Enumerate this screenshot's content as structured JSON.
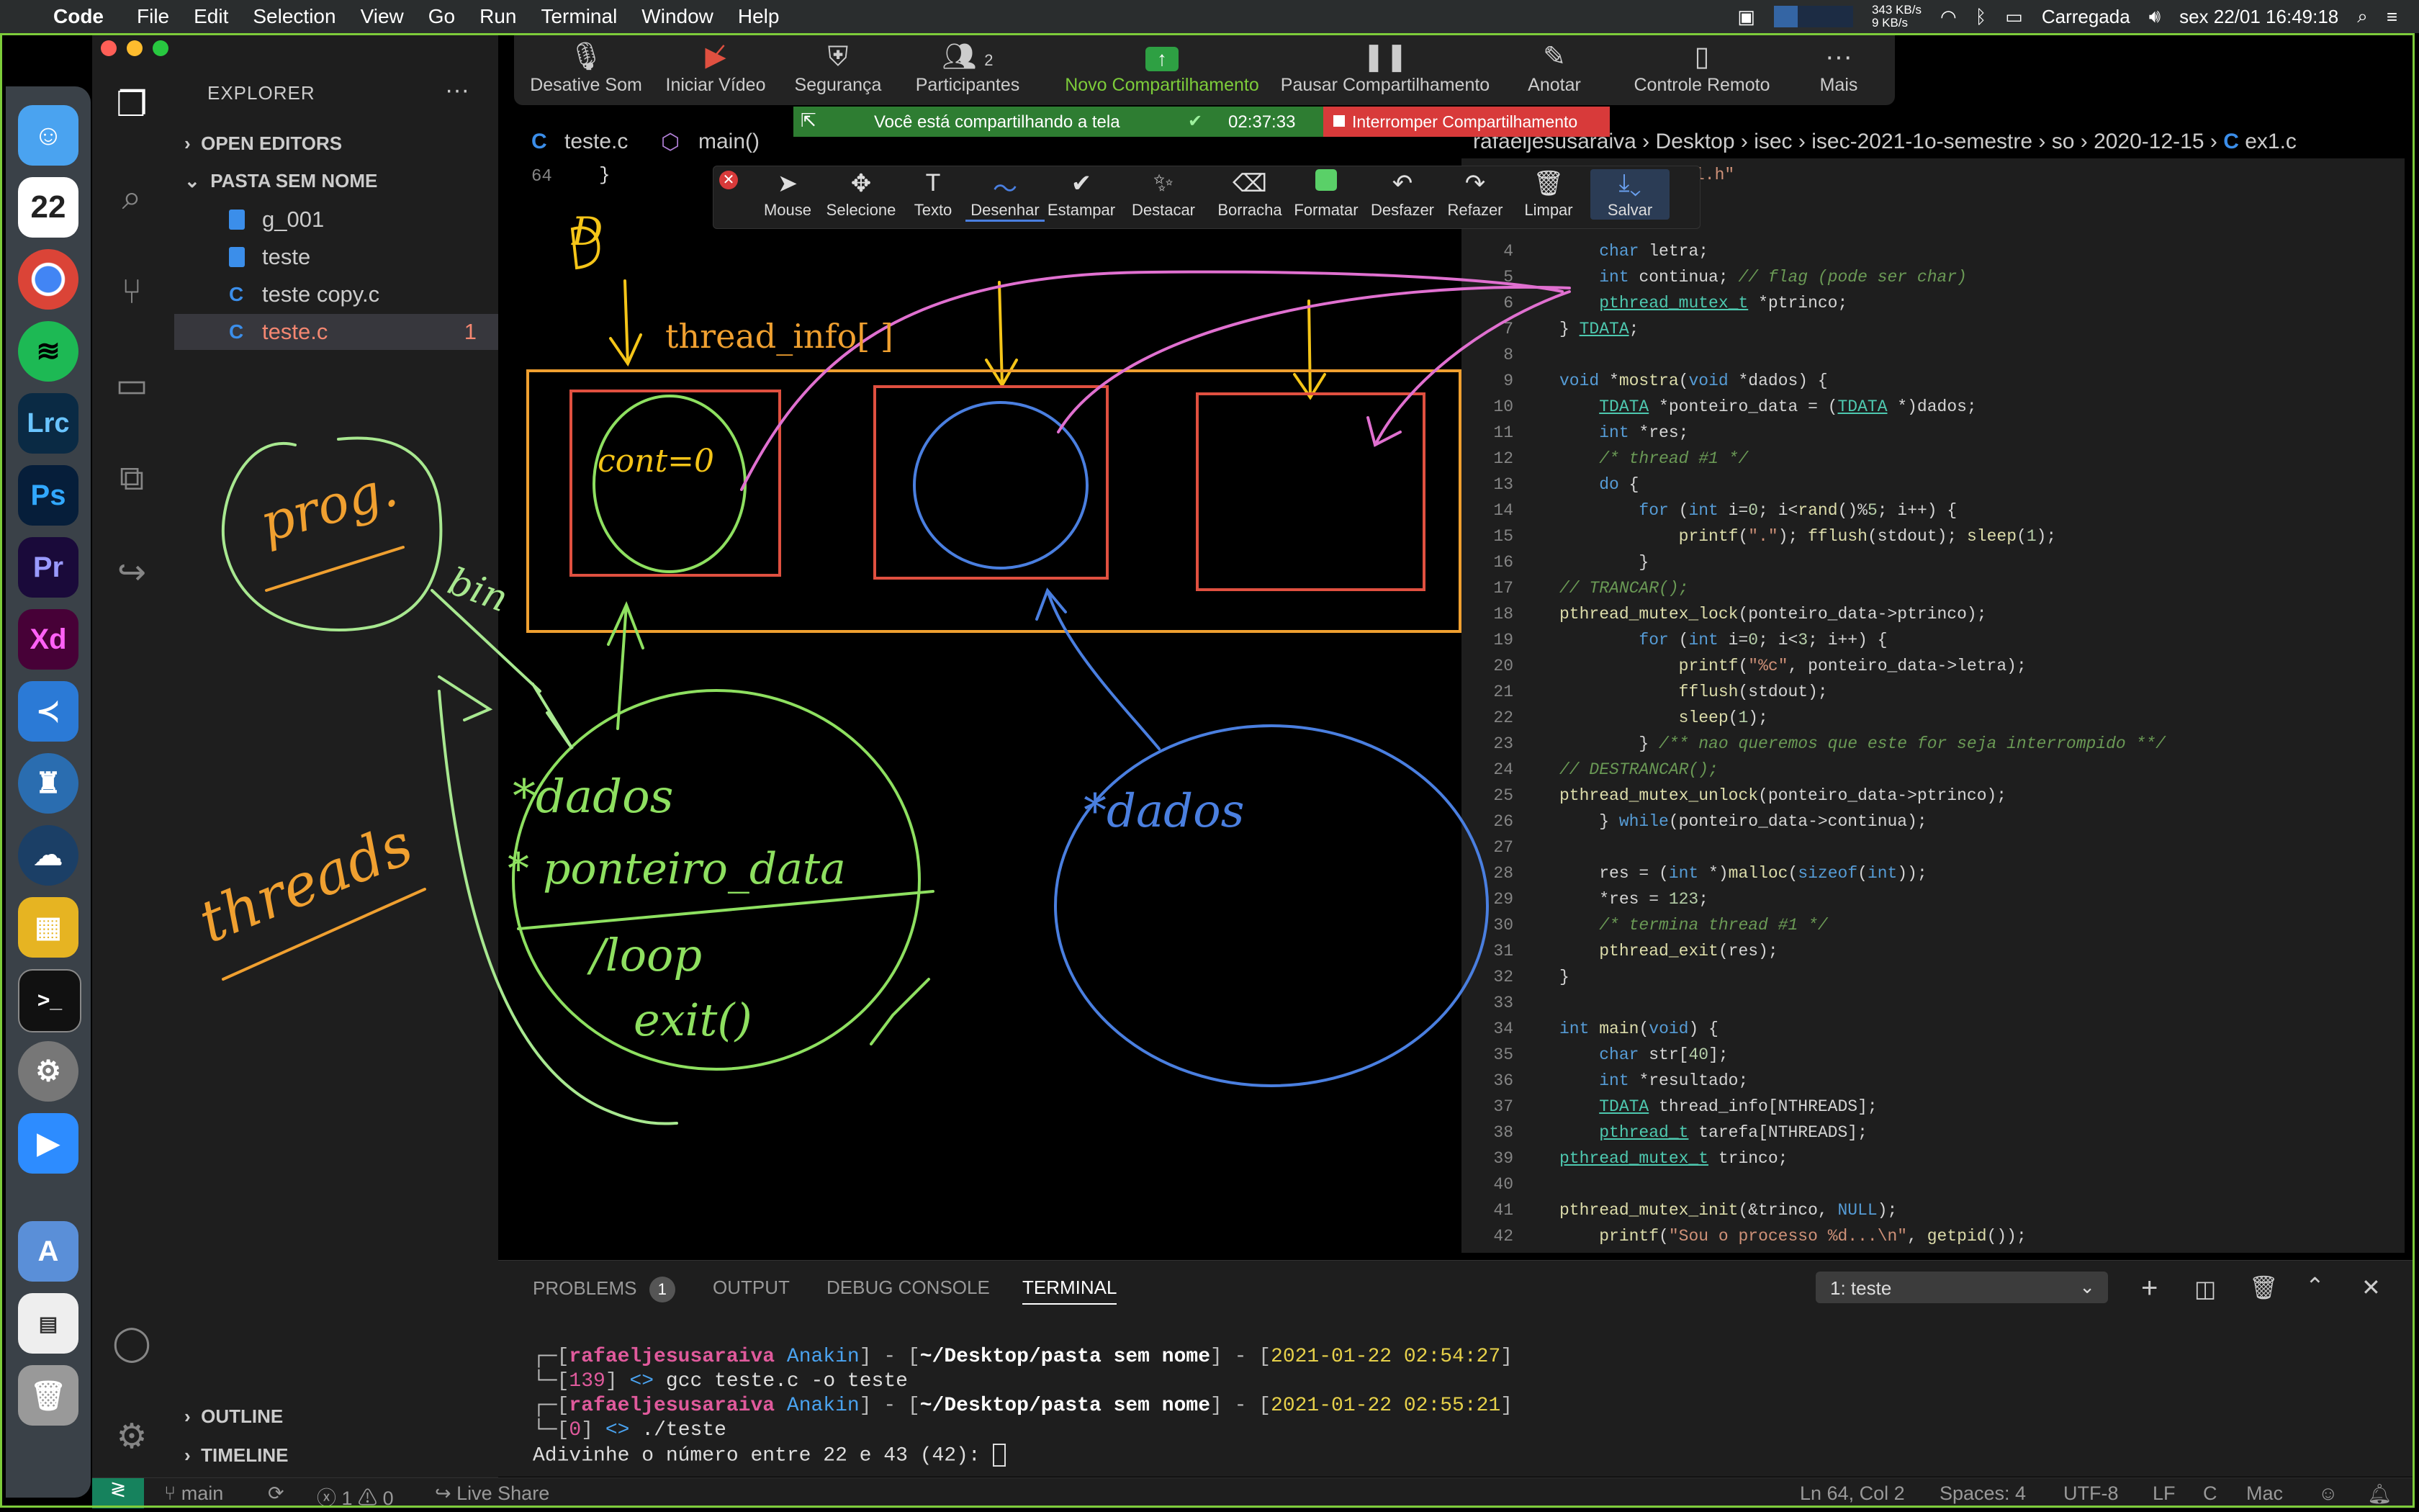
{
  "menubar": {
    "app": "Code",
    "items": [
      "File",
      "Edit",
      "Selection",
      "View",
      "Go",
      "Run",
      "Terminal",
      "Window",
      "Help"
    ],
    "net_up": "343 KB/s",
    "net_down": "9 KB/s",
    "battery": "Carregada",
    "clock": "sex 22/01  16:49:18"
  },
  "zoom": {
    "buttons": [
      {
        "label": "Desative Som",
        "icon": "microphone-icon"
      },
      {
        "label": "Iniciar Vídeo",
        "icon": "video-off-icon"
      },
      {
        "label": "Segurança",
        "icon": "shield-icon"
      },
      {
        "label": "Participantes",
        "icon": "participants-icon",
        "count": "2"
      },
      {
        "label": "Novo Compartilhamento",
        "icon": "share-screen-icon"
      },
      {
        "label": "Pausar Compartilhamento",
        "icon": "pause-icon"
      },
      {
        "label": "Anotar",
        "icon": "pen-icon"
      },
      {
        "label": "Controle Remoto",
        "icon": "mouse-icon"
      },
      {
        "label": "Mais",
        "icon": "more-icon"
      }
    ],
    "banner_text": "Você está compartilhando a tela",
    "banner_timer": "02:37:33",
    "stop_label": "Interromper Compartilhamento",
    "draw_tools": [
      "Mouse",
      "Selecione",
      "Texto",
      "Desenhar",
      "Estampar",
      "Destacar",
      "Borracha",
      "Formatar",
      "Desfazer",
      "Refazer",
      "Limpar",
      "Salvar"
    ]
  },
  "explorer": {
    "title": "EXPLORER",
    "open_editors": "OPEN EDITORS",
    "folder": "PASTA SEM NOME",
    "files": [
      {
        "name": "g_001",
        "type": "file"
      },
      {
        "name": "teste",
        "type": "file"
      },
      {
        "name": "teste copy.c",
        "type": "c"
      },
      {
        "name": "teste.c",
        "type": "c",
        "badge": "1"
      }
    ],
    "outline": "OUTLINE",
    "timeline": "TIMELINE"
  },
  "editor": {
    "tab_file": "teste.c",
    "tab_symbol": "main()",
    "line_64": "64",
    "breadcrumb": [
      "rafaeljesusaraiva",
      "Desktop",
      "isec",
      "isec-2021-1o-semestre",
      "so",
      "2020-12-15",
      "ex1.c"
    ],
    "include_fragment": "l.h\""
  },
  "drawing": {
    "label_D": "D",
    "thread_info": "thread_info[ ]",
    "cont": "cont=0",
    "prog": "prog.",
    "bin": "bin",
    "threads": "threads",
    "dados1": "*dados",
    "ponteiro": "* ponteiro_data",
    "loop": "/loop",
    "exit": "exit()",
    "dados2": "*dados"
  },
  "panel": {
    "tabs": [
      "PROBLEMS",
      "OUTPUT",
      "DEBUG CONSOLE",
      "TERMINAL"
    ],
    "problems_count": "1",
    "terminal_select": "1: teste",
    "lines": [
      {
        "user": "rafaeljesusaraiva",
        "host": "Anakin",
        "path": "~/Desktop/pasta sem nome",
        "time": "2021-01-22 02:54:27"
      },
      {
        "code": "139",
        "cmd": "gcc teste.c -o teste"
      },
      {
        "user": "rafaeljesusaraiva",
        "host": "Anakin",
        "path": "~/Desktop/pasta sem nome",
        "time": "2021-01-22 02:55:21"
      },
      {
        "code": "0",
        "cmd": "./teste"
      }
    ],
    "prompt_out": "Adivinhe o número entre 22 e 43 (42): "
  },
  "status": {
    "branch": "main",
    "errors": "1",
    "warnings": "0",
    "live_share": "Live Share",
    "position": "Ln 64, Col 2",
    "spaces": "Spaces: 4",
    "encoding": "UTF-8",
    "eol": "LF",
    "lang": "C",
    "os": "Mac"
  },
  "colors": {
    "share_green": "#7dcc3a",
    "draw_yellow": "#f5c518",
    "draw_orange": "#f0a030",
    "draw_red": "#e05040",
    "draw_green": "#8ee060",
    "draw_blue": "#4a7fe0",
    "draw_pink": "#e070d0"
  }
}
